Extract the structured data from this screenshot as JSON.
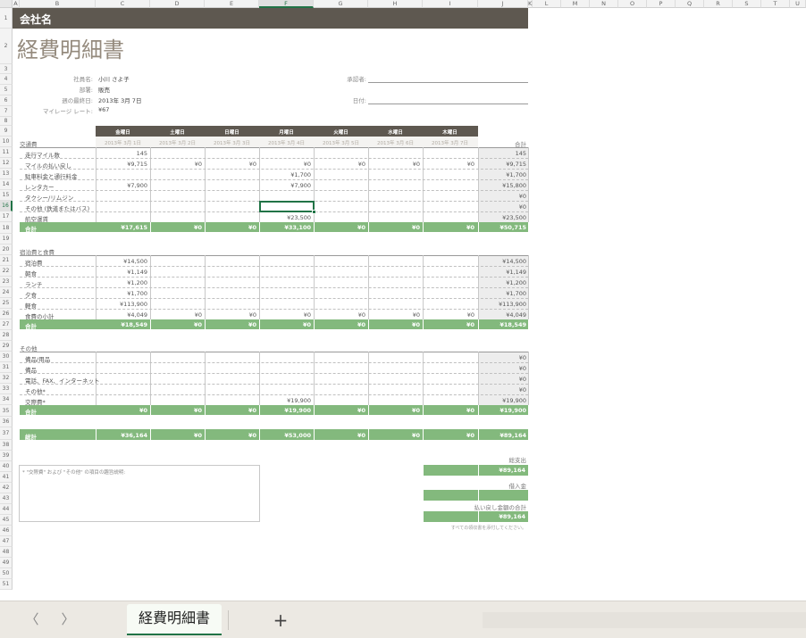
{
  "columns": [
    "A",
    "B",
    "C",
    "D",
    "E",
    "F",
    "G",
    "H",
    "I",
    "J",
    "K",
    "L",
    "M",
    "N",
    "O",
    "P",
    "Q",
    "R",
    "S",
    "T",
    "U"
  ],
  "selected_col": "F",
  "selected_row": "16",
  "rows": [
    "1",
    "2",
    "3",
    "4",
    "5",
    "6",
    "7",
    "8",
    "9",
    "10",
    "11",
    "12",
    "13",
    "14",
    "15",
    "16",
    "17",
    "18",
    "19",
    "20",
    "21",
    "22",
    "23",
    "24",
    "25",
    "26",
    "27",
    "28",
    "29",
    "30",
    "31",
    "32",
    "33",
    "34",
    "35",
    "36",
    "37",
    "38",
    "39",
    "40",
    "41",
    "42",
    "43",
    "44",
    "45",
    "46",
    "47",
    "48",
    "49",
    "50",
    "51"
  ],
  "company": "会社名",
  "title": "経費明細書",
  "employee": {
    "name_label": "社員名:",
    "name": "小川 さよ子",
    "dept_label": "部署:",
    "dept": "販売",
    "week_label": "週の最終日:",
    "week": "2013年 3月 7日",
    "mileage_label": "マイレージ レート:",
    "mileage": "¥67",
    "approver_label": "承認者:",
    "date_label": "日付:"
  },
  "days": [
    "金曜日",
    "土曜日",
    "日曜日",
    "月曜日",
    "火曜日",
    "水曜日",
    "木曜日"
  ],
  "dates": [
    "2013年 3月 1日",
    "2013年 3月 2日",
    "2013年 3月 3日",
    "2013年 3月 4日",
    "2013年 3月 5日",
    "2013年 3月 6日",
    "2013年 3月 7日"
  ],
  "total_header": "合計",
  "sections": [
    {
      "title": "交通費",
      "rows": [
        {
          "label": "走行マイル数",
          "values": [
            "145",
            "",
            "",
            "",
            "",
            "",
            ""
          ],
          "total": "145"
        },
        {
          "label": "マイルの払い戻し",
          "values": [
            "¥9,715",
            "¥0",
            "¥0",
            "¥0",
            "¥0",
            "¥0",
            "¥0"
          ],
          "total": "¥9,715"
        },
        {
          "label": "駐車料金と通行料金",
          "values": [
            "",
            "",
            "",
            "¥1,700",
            "",
            "",
            ""
          ],
          "total": "¥1,700"
        },
        {
          "label": "レンタカー",
          "values": [
            "¥7,900",
            "",
            "",
            "¥7,900",
            "",
            "",
            ""
          ],
          "total": "¥15,800"
        },
        {
          "label": "タクシー/リムジン",
          "values": [
            "",
            "",
            "",
            "",
            "",
            "",
            ""
          ],
          "total": "¥0"
        },
        {
          "label": "その他 (鉄道またはバス)",
          "values": [
            "",
            "",
            "",
            "",
            "",
            "",
            ""
          ],
          "total": "¥0"
        },
        {
          "label": "航空運賃",
          "values": [
            "",
            "",
            "",
            "¥23,500",
            "",
            "",
            ""
          ],
          "total": "¥23,500"
        }
      ],
      "subtotal": {
        "label": "合計",
        "values": [
          "¥17,615",
          "¥0",
          "¥0",
          "¥33,100",
          "¥0",
          "¥0",
          "¥0"
        ],
        "total": "¥50,715"
      }
    },
    {
      "title": "宿泊費と食費",
      "rows": [
        {
          "label": "宿泊費",
          "values": [
            "¥14,500",
            "",
            "",
            "",
            "",
            "",
            ""
          ],
          "total": "¥14,500"
        },
        {
          "label": "朝食",
          "values": [
            "¥1,149",
            "",
            "",
            "",
            "",
            "",
            ""
          ],
          "total": "¥1,149"
        },
        {
          "label": "ランチ",
          "values": [
            "¥1,200",
            "",
            "",
            "",
            "",
            "",
            ""
          ],
          "total": "¥1,200"
        },
        {
          "label": "夕食",
          "values": [
            "¥1,700",
            "",
            "",
            "",
            "",
            "",
            ""
          ],
          "total": "¥1,700"
        },
        {
          "label": "軽食",
          "values": [
            "¥113,900",
            "",
            "",
            "",
            "",
            "",
            ""
          ],
          "total": "¥113,900"
        },
        {
          "label": "食費の小計",
          "values": [
            "¥4,049",
            "¥0",
            "¥0",
            "¥0",
            "¥0",
            "¥0",
            "¥0"
          ],
          "total": "¥4,049"
        }
      ],
      "subtotal": {
        "label": "合計",
        "values": [
          "¥18,549",
          "¥0",
          "¥0",
          "¥0",
          "¥0",
          "¥0",
          "¥0"
        ],
        "total": "¥18,549"
      }
    },
    {
      "title": "その他",
      "rows": [
        {
          "label": "備品/用品",
          "values": [
            "",
            "",
            "",
            "",
            "",
            "",
            ""
          ],
          "total": "¥0"
        },
        {
          "label": "備品",
          "values": [
            "",
            "",
            "",
            "",
            "",
            "",
            ""
          ],
          "total": "¥0"
        },
        {
          "label": "電話、FAX、インターネット",
          "values": [
            "",
            "",
            "",
            "",
            "",
            "",
            ""
          ],
          "total": "¥0"
        },
        {
          "label": "その他*",
          "values": [
            "",
            "",
            "",
            "",
            "",
            "",
            ""
          ],
          "total": "¥0"
        },
        {
          "label": "交際費*",
          "values": [
            "",
            "",
            "",
            "¥19,900",
            "",
            "",
            ""
          ],
          "total": "¥19,900"
        }
      ],
      "subtotal": {
        "label": "合計",
        "values": [
          "¥0",
          "¥0",
          "¥0",
          "¥19,900",
          "¥0",
          "¥0",
          "¥0"
        ],
        "total": "¥19,900"
      }
    }
  ],
  "grand": {
    "label": "総計",
    "values": [
      "¥36,164",
      "¥0",
      "¥0",
      "¥53,000",
      "¥0",
      "¥0",
      "¥0"
    ],
    "total": "¥89,164"
  },
  "note": "* \"交際費\" および \"その他\" の項目の趣旨説明:",
  "summary": {
    "expenses_label": "総支出",
    "expenses": "¥89,164",
    "advance_label": "借入金",
    "advance": "",
    "refund_label": "払い戻し金額の合計",
    "refund": "¥89,164",
    "receipt_note": "すべての領収書を添付してください。"
  },
  "tab": {
    "name": "経費明細書",
    "add": "+",
    "prev": "〈",
    "next": "〉"
  }
}
